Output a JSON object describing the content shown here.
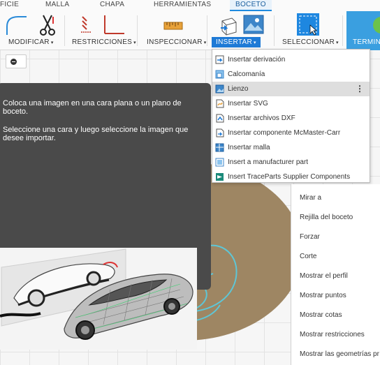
{
  "tabs": [
    {
      "label": "FICIE"
    },
    {
      "label": "MALLA"
    },
    {
      "label": "CHAPA"
    },
    {
      "label": "HERRAMIENTAS"
    },
    {
      "label": "BOCETO"
    }
  ],
  "toolbar": {
    "groups": [
      {
        "label": "MODIFICAR"
      },
      {
        "label": "RESTRICCIONES"
      },
      {
        "label": "INSPECCIONAR"
      },
      {
        "label": "INSERTAR"
      },
      {
        "label": "SELECCIONAR"
      },
      {
        "label": "TERMINA"
      }
    ],
    "caret": "▾"
  },
  "tooltip": {
    "line1": "Coloca una imagen en una cara plana o un plano de boceto.",
    "line2": "Seleccione una cara y luego seleccione la imagen que desee importar."
  },
  "insert_menu": {
    "items": [
      {
        "label": "Insertar derivación",
        "icon": "derive-icon"
      },
      {
        "label": "Calcomanía",
        "icon": "decal-icon"
      },
      {
        "label": "Lienzo",
        "icon": "canvas-icon"
      },
      {
        "label": "Insertar SVG",
        "icon": "svg-icon"
      },
      {
        "label": "Insertar archivos DXF",
        "icon": "dxf-icon"
      },
      {
        "label": "Insertar componente McMaster-Carr",
        "icon": "mcmaster-icon"
      },
      {
        "label": "Insertar malla",
        "icon": "mesh-icon"
      },
      {
        "label": "Insert a manufacturer part",
        "icon": "manufacturer-part-icon"
      },
      {
        "label": "Insert TraceParts Supplier Components",
        "icon": "traceparts-icon"
      }
    ],
    "more": "⋮"
  },
  "context_menu": {
    "items": [
      {
        "label": "Mirar a"
      },
      {
        "label": "Rejilla del boceto"
      },
      {
        "label": "Forzar"
      },
      {
        "label": "Corte"
      },
      {
        "label": "Mostrar el perfil"
      },
      {
        "label": "Mostrar puntos"
      },
      {
        "label": "Mostrar cotas"
      },
      {
        "label": "Mostrar restricciones"
      },
      {
        "label": "Mostrar las geometrías pr"
      }
    ]
  },
  "colors": {
    "accent": "#1e7ad6",
    "tooltip_bg": "#4a4a4a",
    "disc": "#9e8663",
    "curve": "#5ec6d6"
  }
}
